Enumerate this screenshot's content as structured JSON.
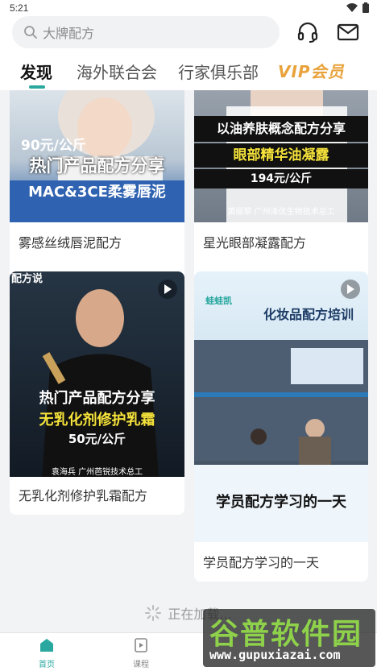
{
  "status_bar": {
    "time": "5:21"
  },
  "search": {
    "placeholder": "大牌配方"
  },
  "tabs": [
    {
      "label": "发现"
    },
    {
      "label": "海外联合会"
    },
    {
      "label": "行家俱乐部"
    },
    {
      "label": "VIP会员"
    }
  ],
  "cards": [
    {
      "title": "雾感丝绒唇泥配方",
      "overlay": {
        "price": "90元/公斤",
        "line1": "热门产品配方分享",
        "line2": "MAC&3CE柔雾唇泥"
      }
    },
    {
      "title": "星光眼部凝露配方",
      "overlay": {
        "line1": "以油养肤概念配方分享",
        "line2": "眼部精华油凝露",
        "price": "194元/公斤",
        "caption": "黄丽翠 广州泽优生物技术总工"
      }
    },
    {
      "title": "无乳化剂修护乳霜配方",
      "overlay": {
        "badge": "配方说",
        "line1": "热门产品配方分享",
        "line2": "无乳化剂修护乳霜",
        "price": "50元/公斤",
        "caption": "袁海兵 广州芭锐技术总工"
      }
    },
    {
      "title": "学员配方学习的一天",
      "overlay": {
        "logo": "蛙蛙凯",
        "headline": "化妆品配方培训",
        "line1": "学员配方学习的一天"
      }
    }
  ],
  "loading": {
    "text": "正在加载..."
  },
  "bottom_nav": [
    {
      "label": "首页",
      "active": true
    },
    {
      "label": "课程",
      "active": false
    }
  ],
  "watermark": {
    "name": "谷普软件园",
    "url": "www.gupuxiazai.com"
  },
  "colors": {
    "accent": "#2aa8a0",
    "vip": "#e8a33c",
    "highlight_yellow": "#f5e23a"
  }
}
